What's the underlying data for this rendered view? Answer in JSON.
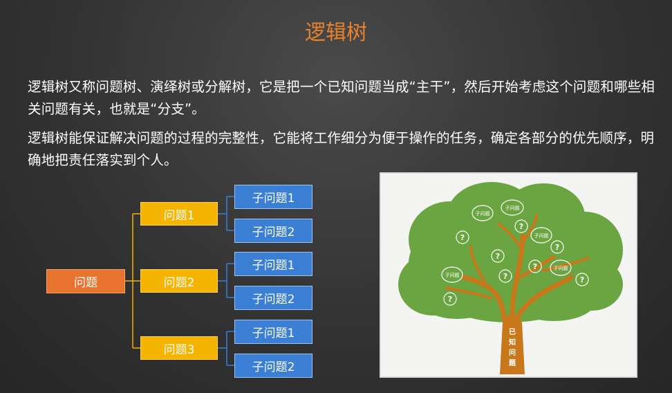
{
  "title": "逻辑树",
  "paragraphs": [
    "逻辑树又称问题树、演绎树或分解树，它是把一个已知问题当成“主干”，然后开始考虑这个问题和哪些相关问题有关，也就是“分支”。",
    "逻辑树能保证解决问题的过程的完整性，它能将工作细分为便于操作的任务，确定各部分的优先顺序，明确地把责任落实到个人。"
  ],
  "diagram": {
    "root": "问题",
    "branches": [
      {
        "label": "问题1",
        "children": [
          "子问题1",
          "子问题2"
        ]
      },
      {
        "label": "问题2",
        "children": [
          "子问题1",
          "子问题2"
        ]
      },
      {
        "label": "问题3",
        "children": [
          "子问题1",
          "子问题2"
        ]
      }
    ]
  },
  "tree_image": {
    "trunk_label": "已\n知\n问\n题",
    "sub_label": "子问题",
    "unknown_label": "?",
    "colors": {
      "canopy": "#6aa542",
      "trunk": "#c8781a"
    }
  }
}
